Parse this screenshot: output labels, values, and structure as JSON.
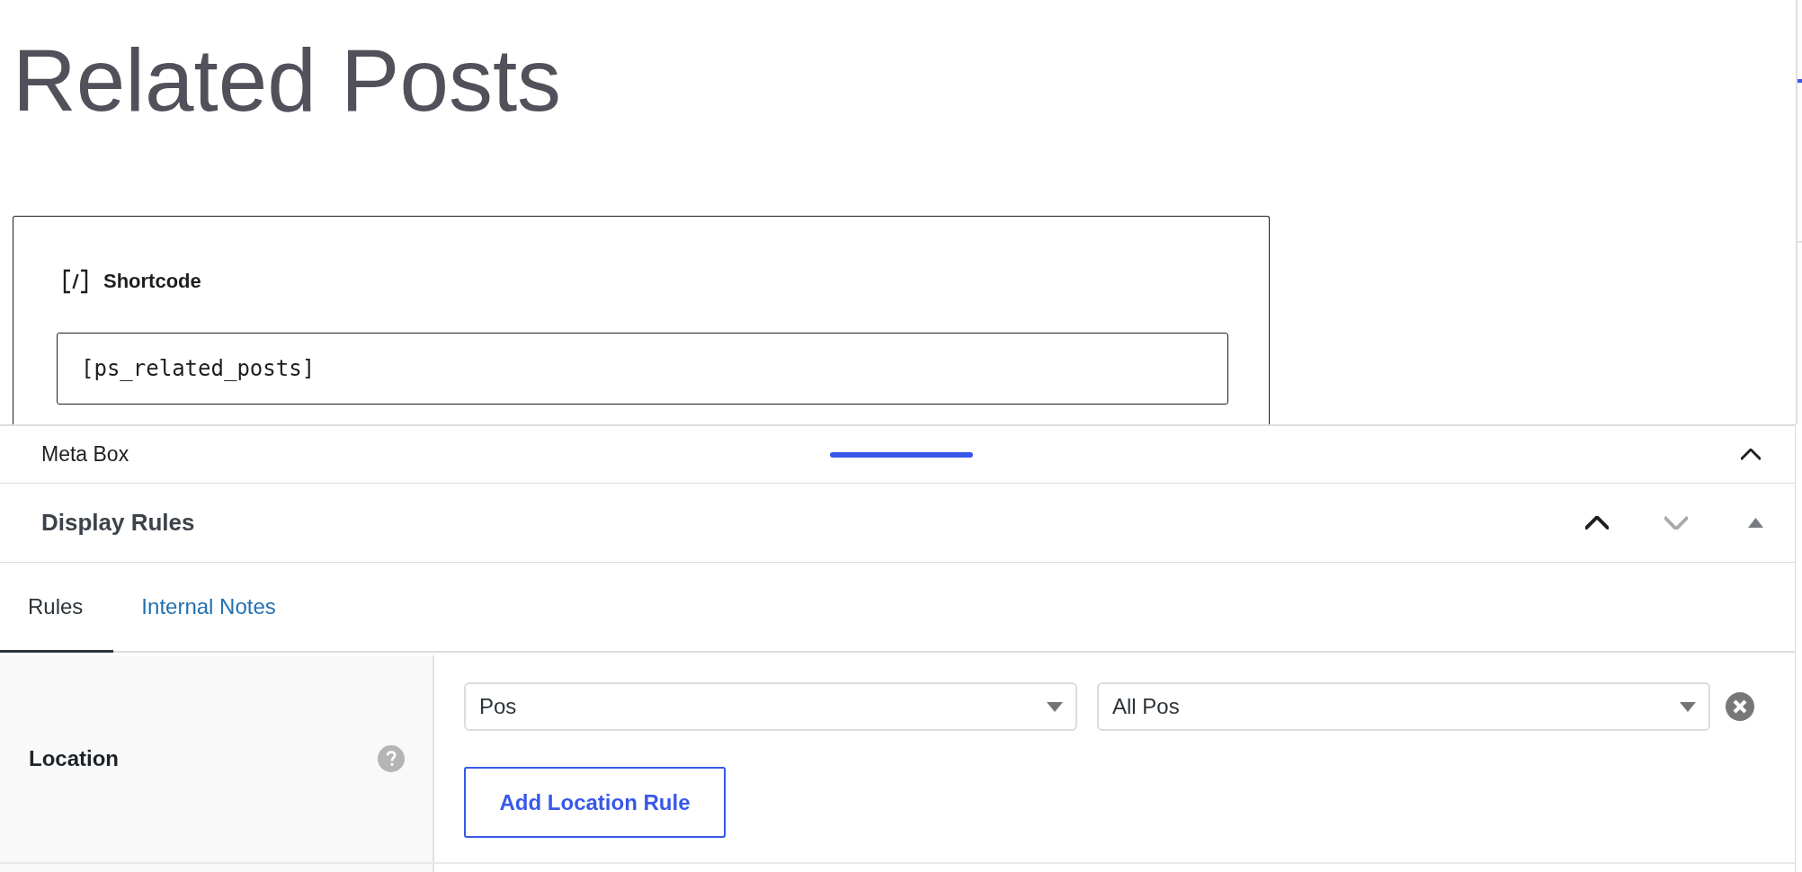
{
  "page": {
    "title": "Related Posts"
  },
  "shortcode": {
    "heading": "Shortcode",
    "value": "[ps_related_posts]"
  },
  "meta_box": {
    "title": "Meta Box",
    "expanded": true
  },
  "display_rules": {
    "title": "Display Rules",
    "expanded": true,
    "controls": [
      {
        "kind": "move-up",
        "disabled": false
      },
      {
        "kind": "move-down",
        "disabled": true
      },
      {
        "kind": "toggle",
        "disabled": false
      }
    ]
  },
  "tabs": [
    {
      "label": "Rules",
      "selected": true
    },
    {
      "label": "Internal Notes",
      "selected": false
    }
  ],
  "rules": [
    {
      "label": "Location",
      "conditions": [
        {
          "param": "Pos",
          "value": "All Pos"
        }
      ],
      "add_button": "Add Location Rule"
    }
  ]
}
